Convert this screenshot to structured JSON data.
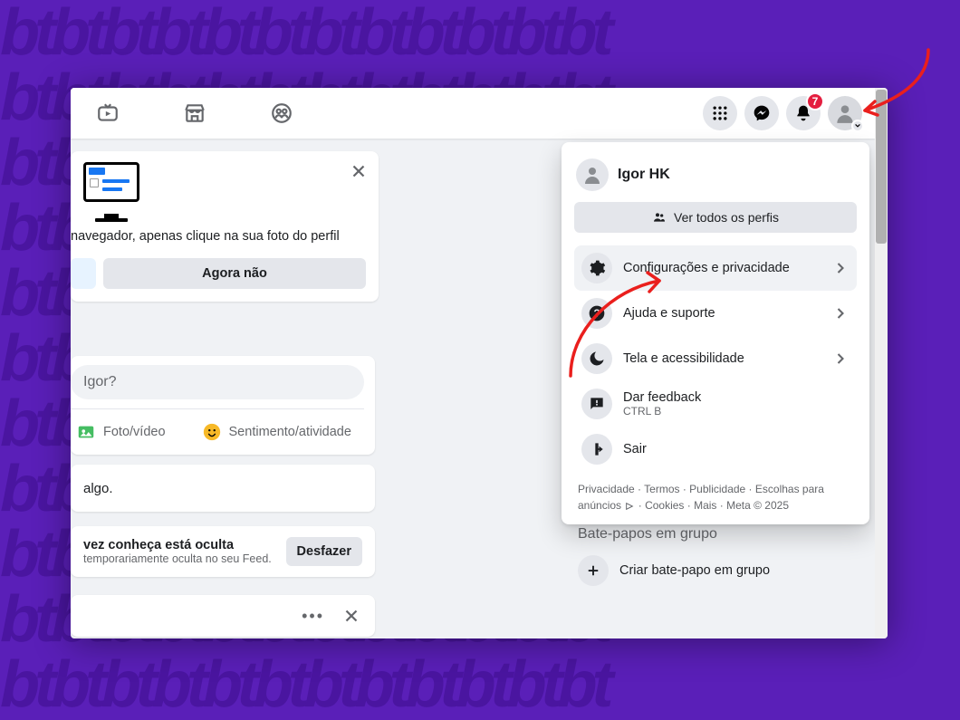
{
  "topbar": {
    "notification_count": "7"
  },
  "card_login": {
    "text": "navegador, apenas clique na sua foto do perfil",
    "secondary_btn": "Agora não"
  },
  "composer": {
    "placeholder_fragment": "Igor?",
    "action_photo": "Foto/vídeo",
    "action_feeling": "Sentimento/atividade"
  },
  "card_algo": {
    "text_fragment": "algo."
  },
  "card_hidden": {
    "title_fragment": "vez conheça está oculta",
    "subtitle_fragment": "temporariamente oculta no seu Feed.",
    "undo": "Desfazer"
  },
  "popup": {
    "profile_name": "Igor HK",
    "see_all": "Ver todos os perfis",
    "items": {
      "settings": "Configurações e privacidade",
      "help": "Ajuda e suporte",
      "display": "Tela e acessibilidade",
      "feedback": "Dar feedback",
      "feedback_sub": "CTRL B",
      "logout": "Sair"
    },
    "footer": {
      "privacy": "Privacidade",
      "terms": "Termos",
      "ads": "Publicidade",
      "ad_choices": "Escolhas para anúncios",
      "cookies": "Cookies",
      "more": "Mais",
      "meta": "Meta © 2025"
    }
  },
  "group_chat": {
    "heading": "Bate-papos em grupo",
    "create": "Criar bate-papo em grupo"
  }
}
